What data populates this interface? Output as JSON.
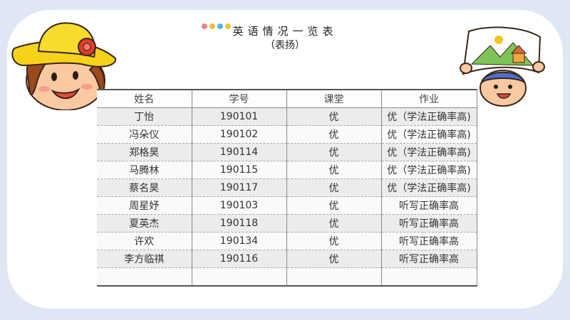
{
  "header": {
    "title": "英语情况一览表",
    "subtitle": "（表扬）",
    "dot_colors": [
      "#f07f86",
      "#f5b942",
      "#4fb6e8",
      "#f2c335"
    ]
  },
  "table": {
    "columns": [
      "姓名",
      "学号",
      "课堂",
      "作业"
    ],
    "rows": [
      [
        "丁怡",
        "190101",
        "优",
        "优（学法正确率高)"
      ],
      [
        "冯朵仪",
        "190102",
        "优",
        "优（学法正确率高)"
      ],
      [
        "郑格昊",
        "190114",
        "优",
        "优（学法正确率高)"
      ],
      [
        "马腾林",
        "190115",
        "优",
        "优（学法正确率高)"
      ],
      [
        "蔡名昊",
        "190117",
        "优",
        "优（学法正确率高)"
      ],
      [
        "周星妤",
        "190103",
        "优",
        "听写正确率高"
      ],
      [
        "夏英杰",
        "190118",
        "优",
        "听写正确率高"
      ],
      [
        "许欢",
        "190134",
        "优",
        "听写正确率高"
      ],
      [
        "李方临祺",
        "190116",
        "优",
        "听写正确率高"
      ],
      [
        "",
        "",
        "",
        ""
      ]
    ]
  },
  "decorations": {
    "left": "girl-with-hat-icon",
    "right": "boy-holding-drawing-icon"
  }
}
